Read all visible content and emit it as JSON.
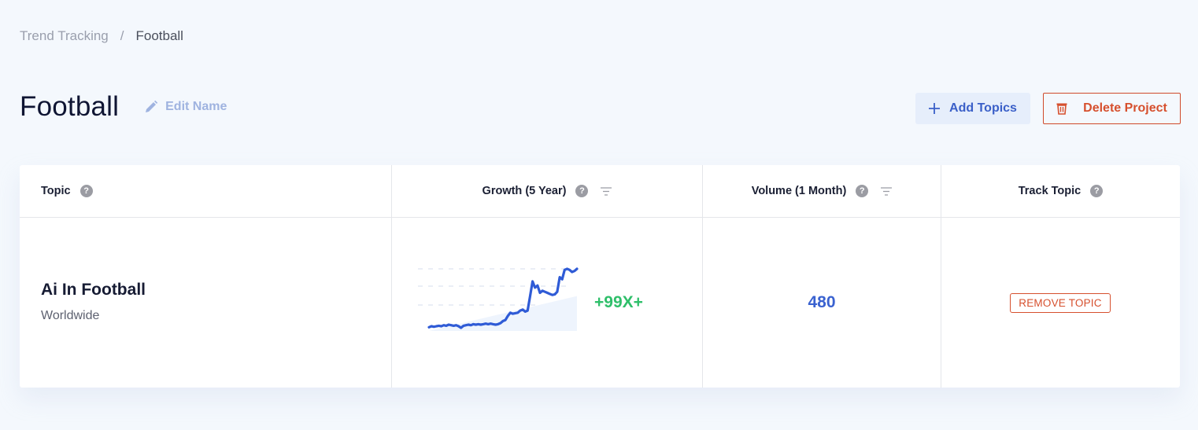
{
  "breadcrumb": {
    "parent": "Trend Tracking",
    "separator": "/",
    "current": "Football"
  },
  "header": {
    "title": "Football",
    "edit_label": "Edit Name",
    "add_topics_label": "Add Topics",
    "delete_project_label": "Delete Project"
  },
  "table": {
    "columns": [
      {
        "label": "Topic",
        "help": "?"
      },
      {
        "label": "Growth (5 Year)",
        "help": "?",
        "sortable": true
      },
      {
        "label": "Volume (1 Month)",
        "help": "?",
        "sortable": true
      },
      {
        "label": "Track Topic",
        "help": "?"
      }
    ],
    "rows": [
      {
        "topic": "Ai In Football",
        "region": "Worldwide",
        "growth": "+99X+",
        "volume": "480",
        "action": "REMOVE TOPIC",
        "trend": [
          2,
          3,
          2.5,
          3,
          3.5,
          3,
          4,
          3.5,
          4.5,
          4,
          3.5,
          4,
          3,
          1.5,
          3.5,
          4,
          4.5,
          4,
          5,
          4.5,
          5,
          4.5,
          5,
          5.5,
          5,
          5.5,
          5,
          4.5,
          5,
          6,
          8,
          9,
          13,
          16,
          15,
          15.5,
          16,
          18,
          19,
          17,
          18,
          32,
          46,
          40,
          42,
          35,
          37,
          36,
          35,
          34,
          33,
          33.5,
          36,
          50,
          48,
          57,
          58,
          57,
          55,
          56,
          58
        ]
      }
    ]
  },
  "colors": {
    "accent_blue": "#3a62d0",
    "growth_green": "#2fbf6a",
    "danger_red": "#d6502e",
    "sparkline": "#2f5bd6"
  }
}
